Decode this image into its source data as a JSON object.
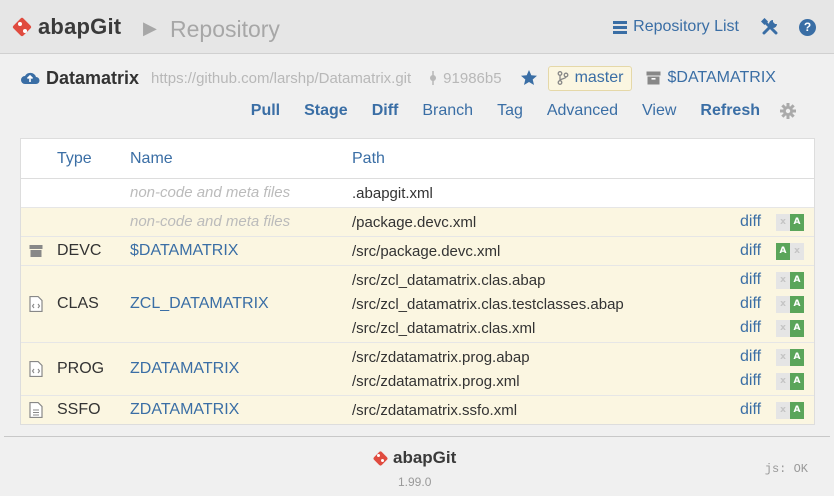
{
  "header": {
    "logo_text": "abapGit",
    "page_title": "Repository",
    "repo_list_label": "Repository List"
  },
  "repo": {
    "name": "Datamatrix",
    "url": "https://github.com/larshp/Datamatrix.git",
    "commit": "91986b5",
    "branch": "master",
    "package": "$DATAMATRIX"
  },
  "toolbar": {
    "pull": "Pull",
    "stage": "Stage",
    "diff": "Diff",
    "branch": "Branch",
    "tag": "Tag",
    "advanced": "Advanced",
    "view": "View",
    "refresh": "Refresh"
  },
  "table": {
    "col_type": "Type",
    "col_name": "Name",
    "col_path": "Path",
    "diff_label": "diff",
    "rows": [
      {
        "type": "",
        "name": "non-code and meta files",
        "paths": [
          ".abapgit.xml"
        ]
      },
      {
        "type": "",
        "name": "non-code and meta files",
        "paths": [
          "/package.devc.xml"
        ]
      },
      {
        "type": "DEVC",
        "name": "$DATAMATRIX",
        "paths": [
          "/src/package.devc.xml"
        ]
      },
      {
        "type": "CLAS",
        "name": "ZCL_DATAMATRIX",
        "paths": [
          "/src/zcl_datamatrix.clas.abap",
          "/src/zcl_datamatrix.clas.testclasses.abap",
          "/src/zcl_datamatrix.clas.xml"
        ]
      },
      {
        "type": "PROG",
        "name": "ZDATAMATRIX",
        "paths": [
          "/src/zdatamatrix.prog.abap",
          "/src/zdatamatrix.prog.xml"
        ]
      },
      {
        "type": "SSFO",
        "name": "ZDATAMATRIX",
        "paths": [
          "/src/zdatamatrix.ssfo.xml"
        ]
      }
    ],
    "status_letter": "A",
    "status_empty": "x"
  },
  "footer": {
    "logo_text": "abapGit",
    "version": "1.99.0",
    "js_status": "js: OK"
  },
  "colors": {
    "link": "#3a6ea5",
    "logo_red": "#e04b3f",
    "modified_row": "#fbf6e1",
    "status_added": "#5aa55a"
  }
}
